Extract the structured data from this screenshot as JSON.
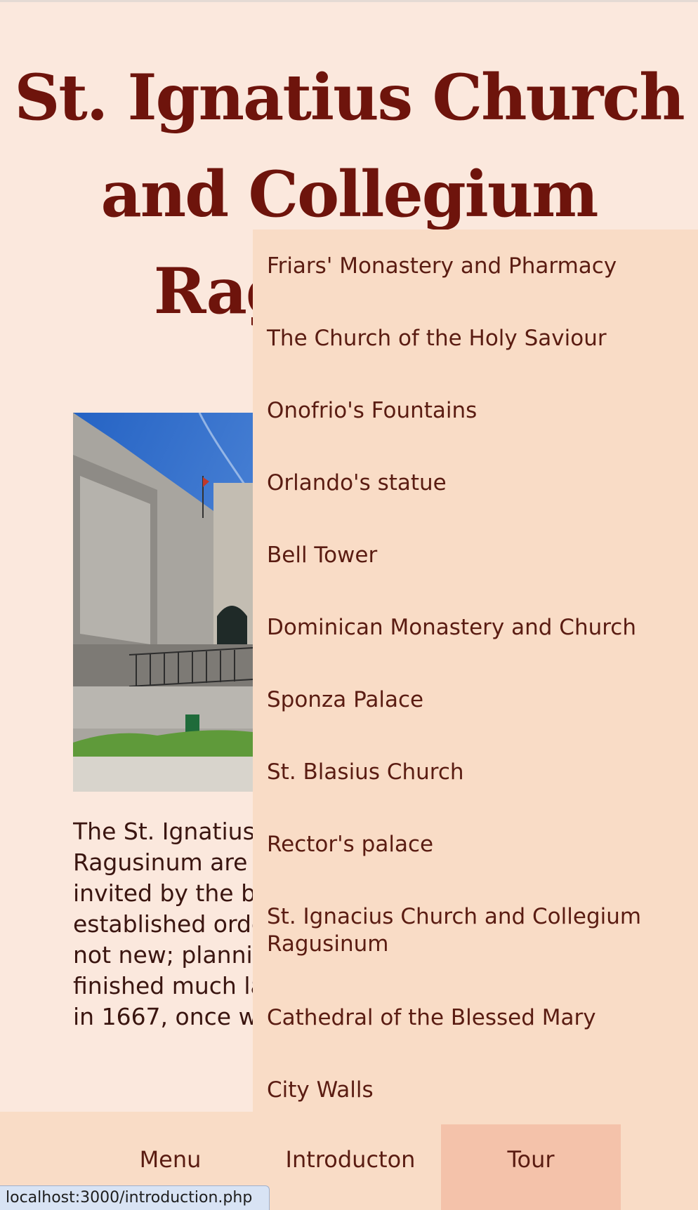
{
  "page": {
    "title": "St. Ignatius Church and Collegium Ragusinum",
    "body_text": "The St. Ignatius Church and Collegium Ragusinum are housed by the Jesuits, invited by the bishop of Dubrovnik, who established order in the city. The idea was not new; planning started early and finished much later, after the earthquake in 1667, once went to t"
  },
  "dropdown": {
    "items": [
      "Friars' Monastery and Pharmacy",
      "The Church of the Holy Saviour",
      "Onofrio's Fountains",
      "Orlando's statue",
      "Bell Tower",
      "Dominican Monastery and Church",
      "Sponza Palace",
      "St. Blasius Church",
      "Rector's palace",
      "St. Ignacius Church and Collegium Ragusinum",
      "Cathedral of the Blessed Mary",
      "City Walls"
    ]
  },
  "nav": {
    "menu": "Menu",
    "introduction": "Introducton",
    "tour": "Tour"
  },
  "status_bar": {
    "url": "localhost:3000/introduction.php"
  },
  "colors": {
    "background": "#fbe8dd",
    "title": "#6e140c",
    "dropdown_bg": "#f9dcc6",
    "active_tab": "#f4c2aa"
  }
}
